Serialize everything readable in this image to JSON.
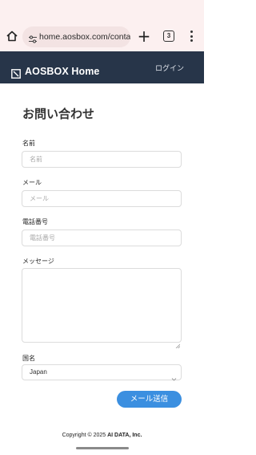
{
  "browser": {
    "url": "home.aosbox.com/conta",
    "tab_count": "3"
  },
  "header": {
    "brand": "AOSBOX Home",
    "login": "ログイン"
  },
  "form": {
    "title": "お問い合わせ",
    "name_label": "名前",
    "name_placeholder": "名前",
    "email_label": "メール",
    "email_placeholder": "メール",
    "phone_label": "電話番号",
    "phone_placeholder": "電話番号",
    "message_label": "メッセージ",
    "country_label": "国名",
    "country_value": "Japan",
    "submit_label": "メール送信"
  },
  "footer": {
    "prefix": "Copyright © 2025 ",
    "company": "AI DATA, Inc."
  },
  "colors": {
    "browser_bg": "#fcf0f0",
    "navbar_bg": "#273549",
    "accent": "#3b8fe0"
  },
  "icons": [
    "home-icon",
    "site-settings-icon",
    "new-tab-icon",
    "tab-switcher-icon",
    "more-menu-icon",
    "brand-logo-icon",
    "chevron-down-icon",
    "resize-grip-icon"
  ]
}
